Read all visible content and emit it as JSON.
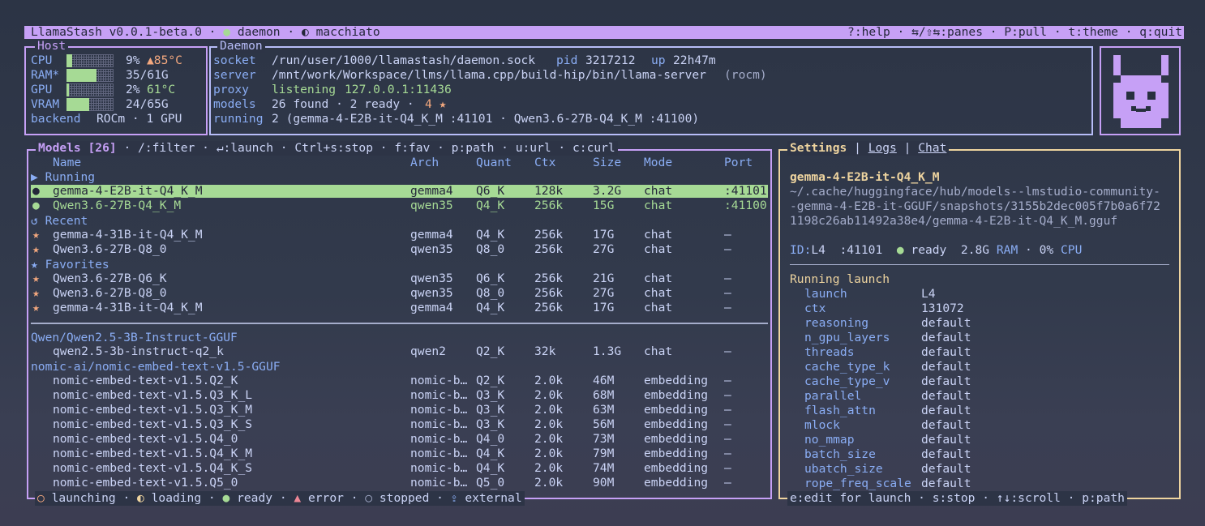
{
  "title_bar": {
    "app_name": "LlamaStash v0.0.1-beta.0",
    "sep": "·",
    "daemon_dot": "●",
    "daemon_label": "daemon",
    "theme_icon": "◐",
    "theme_name": "macchiato",
    "shortcuts": "?:help · ⇆/⇧⇆:panes · P:pull · t:theme · q:quit"
  },
  "host": {
    "title": "Host",
    "cpu_label": "CPU",
    "cpu_pct": "9%",
    "cpu_temp": "▲85°C",
    "cpu_level": 0.09,
    "ram_label": "RAM*",
    "ram_value": "35/61G",
    "ram_level": 0.57,
    "gpu_label": "GPU",
    "gpu_pct": "2%",
    "gpu_temp": "61°C",
    "gpu_level": 0.02,
    "vram_label": "VRAM",
    "vram_value": "24/65G",
    "vram_level": 0.37,
    "backend_label": "backend",
    "backend_value": "ROCm · 1 GPU"
  },
  "daemon": {
    "title": "Daemon",
    "socket_label": "socket",
    "socket_value": "/run/user/1000/llamastash/daemon.sock",
    "pid_label": "pid",
    "pid_value": "3217212",
    "up_label": "up",
    "up_value": "22h47m",
    "server_label": "server",
    "server_value": "/mnt/work/Workspace/llms/llama.cpp/build-hip/bin/llama-server",
    "server_note": "(rocm)",
    "proxy_label": "proxy",
    "proxy_status": "listening",
    "proxy_addr": "127.0.0.1:11436",
    "models_label": "models",
    "models_value": "26 found · 2 ready ·",
    "models_fav": "4 ★",
    "running_label": "running",
    "running_value": "2 (gemma-4-E2B-it-Q4_K_M :41101 · Qwen3.6-27B-Q4_K_M :41100)"
  },
  "models_panel": {
    "title": "Models [26]",
    "hints": "/:filter · ↵:launch · Ctrl+s:stop · f:fav · p:path · u:url · c:curl",
    "columns": {
      "name": "Name",
      "arch": "Arch",
      "quant": "Quant",
      "ctx": "Ctx",
      "size": "Size",
      "mode": "Mode",
      "port": "Port"
    },
    "section_running": "▶ Running",
    "running": [
      {
        "mark": "●",
        "name": "gemma-4-E2B-it-Q4_K_M",
        "arch": "gemma4",
        "quant": "Q6_K",
        "ctx": "128k",
        "size": "3.2G",
        "mode": "chat",
        "port": ":41101"
      },
      {
        "mark": "●",
        "name": "Qwen3.6-27B-Q4_K_M",
        "arch": "qwen35",
        "quant": "Q4_K",
        "ctx": "256k",
        "size": "15G",
        "mode": "chat",
        "port": ":41100"
      }
    ],
    "section_recent": "↺ Recent",
    "recent": [
      {
        "mark": "★",
        "name": "gemma-4-31B-it-Q4_K_M",
        "arch": "gemma4",
        "quant": "Q4_K",
        "ctx": "256k",
        "size": "17G",
        "mode": "chat",
        "port": "—"
      },
      {
        "mark": "★",
        "name": "Qwen3.6-27B-Q8_0",
        "arch": "qwen35",
        "quant": "Q8_0",
        "ctx": "256k",
        "size": "27G",
        "mode": "chat",
        "port": "—"
      }
    ],
    "section_favorites": "★ Favorites",
    "favorites": [
      {
        "mark": "★",
        "name": "Qwen3.6-27B-Q6_K",
        "arch": "qwen35",
        "quant": "Q6_K",
        "ctx": "256k",
        "size": "21G",
        "mode": "chat",
        "port": "—"
      },
      {
        "mark": "★",
        "name": "Qwen3.6-27B-Q8_0",
        "arch": "qwen35",
        "quant": "Q8_0",
        "ctx": "256k",
        "size": "27G",
        "mode": "chat",
        "port": "—"
      },
      {
        "mark": "★",
        "name": "gemma-4-31B-it-Q4_K_M",
        "arch": "gemma4",
        "quant": "Q4_K",
        "ctx": "256k",
        "size": "17G",
        "mode": "chat",
        "port": "—"
      }
    ],
    "group1": "Qwen/Qwen2.5-3B-Instruct-GGUF",
    "group1_rows": [
      {
        "mark": "",
        "name": "qwen2.5-3b-instruct-q2_k",
        "arch": "qwen2",
        "quant": "Q2_K",
        "ctx": "32k",
        "size": "1.3G",
        "mode": "chat",
        "port": "—"
      }
    ],
    "group2": "nomic-ai/nomic-embed-text-v1.5-GGUF",
    "group2_rows": [
      {
        "mark": "",
        "name": "nomic-embed-text-v1.5.Q2_K",
        "arch": "nomic-b…",
        "quant": "Q2_K",
        "ctx": "2.0k",
        "size": "46M",
        "mode": "embedding",
        "port": "—"
      },
      {
        "mark": "",
        "name": "nomic-embed-text-v1.5.Q3_K_L",
        "arch": "nomic-b…",
        "quant": "Q3_K",
        "ctx": "2.0k",
        "size": "68M",
        "mode": "embedding",
        "port": "—"
      },
      {
        "mark": "",
        "name": "nomic-embed-text-v1.5.Q3_K_M",
        "arch": "nomic-b…",
        "quant": "Q3_K",
        "ctx": "2.0k",
        "size": "63M",
        "mode": "embedding",
        "port": "—"
      },
      {
        "mark": "",
        "name": "nomic-embed-text-v1.5.Q3_K_S",
        "arch": "nomic-b…",
        "quant": "Q3_K",
        "ctx": "2.0k",
        "size": "56M",
        "mode": "embedding",
        "port": "—"
      },
      {
        "mark": "",
        "name": "nomic-embed-text-v1.5.Q4_0",
        "arch": "nomic-b…",
        "quant": "Q4_0",
        "ctx": "2.0k",
        "size": "73M",
        "mode": "embedding",
        "port": "—"
      },
      {
        "mark": "",
        "name": "nomic-embed-text-v1.5.Q4_K_M",
        "arch": "nomic-b…",
        "quant": "Q4_K",
        "ctx": "2.0k",
        "size": "79M",
        "mode": "embedding",
        "port": "—"
      },
      {
        "mark": "",
        "name": "nomic-embed-text-v1.5.Q4_K_S",
        "arch": "nomic-b…",
        "quant": "Q4_K",
        "ctx": "2.0k",
        "size": "74M",
        "mode": "embedding",
        "port": "—"
      },
      {
        "mark": "",
        "name": "nomic-embed-text-v1.5.Q5_0",
        "arch": "nomic-b…",
        "quant": "Q5_0",
        "ctx": "2.0k",
        "size": "90M",
        "mode": "embedding",
        "port": "—"
      }
    ],
    "legend": [
      {
        "icon": "○",
        "label": "launching",
        "color": "#f5a97f"
      },
      {
        "icon": "◐",
        "label": "loading",
        "color": "#eed49f"
      },
      {
        "icon": "●",
        "label": "ready",
        "color": "#a6da95"
      },
      {
        "icon": "▲",
        "label": "error",
        "color": "#ed8796"
      },
      {
        "icon": "○",
        "label": "stopped",
        "color": "#a5adcb"
      },
      {
        "icon": "⇪",
        "label": "external",
        "color": "#8aadf4"
      }
    ]
  },
  "side_panel": {
    "tabs": [
      "Settings",
      "Logs",
      "Chat"
    ],
    "active_tab": "Settings",
    "model_name": "gemma-4-E2B-it-Q4_K_M",
    "path_lines": [
      "~/.cache/huggingface/hub/models--lmstudio-community-",
      "-gemma-4-E2B-it-GGUF/snapshots/3155b2dec005f7b0a6f72",
      "1198c26ab11492a38e4/gemma-4-E2B-it-Q4_K_M.gguf"
    ],
    "id_label": "ID:",
    "id_value": "L4",
    "port": ":41101",
    "status_dot": "●",
    "status": "ready",
    "ram_value": "2.8G",
    "ram_label": "RAM",
    "cpu_value": "0%",
    "cpu_label": "CPU",
    "section": "Running launch",
    "settings": [
      {
        "key": "launch",
        "value": "L4"
      },
      {
        "key": "ctx",
        "value": "131072"
      },
      {
        "key": "reasoning",
        "value": "default"
      },
      {
        "key": "n_gpu_layers",
        "value": "default"
      },
      {
        "key": "threads",
        "value": "default"
      },
      {
        "key": "cache_type_k",
        "value": "default"
      },
      {
        "key": "cache_type_v",
        "value": "default"
      },
      {
        "key": "parallel",
        "value": "default"
      },
      {
        "key": "flash_attn",
        "value": "default"
      },
      {
        "key": "mlock",
        "value": "default"
      },
      {
        "key": "no_mmap",
        "value": "default"
      },
      {
        "key": "batch_size",
        "value": "default"
      },
      {
        "key": "ubatch_size",
        "value": "default"
      },
      {
        "key": "rope_freq_scale",
        "value": "default"
      }
    ],
    "footer": "e:edit for launch · s:stop · ↑↓:scroll · p:path"
  }
}
